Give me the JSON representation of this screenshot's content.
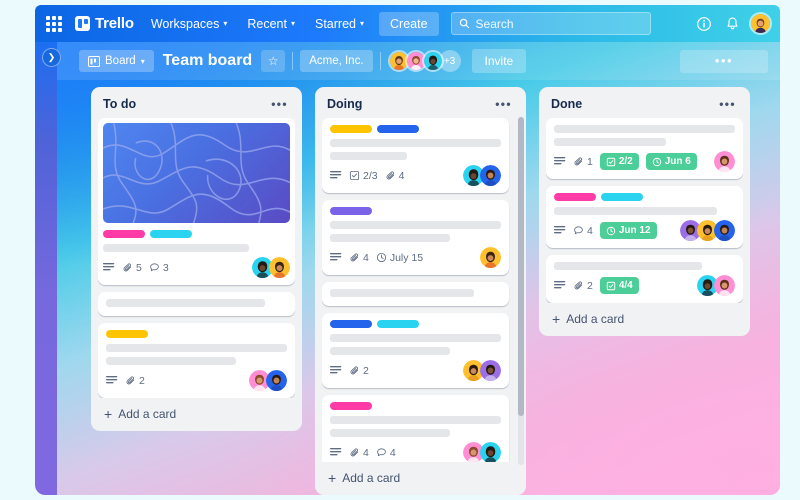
{
  "topnav": {
    "apps_icon": "grid-apps-icon",
    "brand": "Trello",
    "items": [
      {
        "label": "Workspaces",
        "caret": "▾"
      },
      {
        "label": "Recent",
        "caret": "▾"
      },
      {
        "label": "Starred",
        "caret": "▾"
      }
    ],
    "create_label": "Create",
    "search": {
      "placeholder": "Search",
      "value": "",
      "icon": "search-icon"
    },
    "info_icon": "info-icon",
    "bell_icon": "notification-bell-icon",
    "avatar": "user-avatar"
  },
  "board_header": {
    "sidebar_toggle_icon": "chevron-right-icon",
    "view_label": "Board",
    "view_caret": "▾",
    "view_icon": "board-view-icon",
    "title": "Team board",
    "star_icon": "☆",
    "workspace": "Acme, Inc.",
    "members": [
      {
        "name": "member-1",
        "face": "#ffc02e"
      },
      {
        "name": "member-2",
        "face": "#ff8ed4"
      },
      {
        "name": "member-3",
        "face": "#2ad4f0"
      }
    ],
    "overflow_count": "+3",
    "invite_label": "Invite",
    "menu_label": "•••"
  },
  "lists": [
    {
      "title": "To do",
      "menu": "•••",
      "add_card": "Add a card",
      "cards": [
        {
          "name": "card-cover-todo-1",
          "cover": true,
          "labels": [
            "#ff3ba8",
            "#2ad4f0"
          ],
          "skeletons": [
            100
          ],
          "meta": [
            {
              "icon": "description-icon",
              "text": ""
            },
            {
              "icon": "attachment-icon",
              "text": "5"
            },
            {
              "icon": "comment-icon",
              "text": "3"
            }
          ],
          "badges": [],
          "avatars": [
            "#2ad4f0",
            "#ffc02e"
          ]
        },
        {
          "name": "card-todo-2",
          "cover": false,
          "labels": [],
          "skeletons": [
            85
          ],
          "meta": [],
          "badges": [],
          "avatars": []
        },
        {
          "name": "card-todo-3",
          "cover": false,
          "labels": [
            "#ffc400"
          ],
          "skeletons": [
            100,
            76
          ],
          "meta": [
            {
              "icon": "description-icon",
              "text": ""
            },
            {
              "icon": "attachment-icon",
              "text": "2"
            }
          ],
          "badges": [],
          "avatars": [
            "#ff8ed4",
            "#2463eb"
          ]
        }
      ]
    },
    {
      "title": "Doing",
      "menu": "•••",
      "add_card": "Add a card",
      "scrollbar": true,
      "cards": [
        {
          "name": "card-doing-1",
          "cover": false,
          "labels": [
            "#ffc400",
            "#2463eb"
          ],
          "skeletons": [
            100,
            45
          ],
          "meta": [
            {
              "icon": "description-icon",
              "text": ""
            },
            {
              "icon": "checklist-icon",
              "text": "2/3"
            },
            {
              "icon": "attachment-icon",
              "text": "4"
            }
          ],
          "badges": [],
          "avatars": [
            "#2ad4f0",
            "#2463eb"
          ]
        },
        {
          "name": "card-doing-2",
          "cover": false,
          "labels": [
            "#7a63e8"
          ],
          "skeletons": [
            100,
            70
          ],
          "meta": [
            {
              "icon": "description-icon",
              "text": ""
            },
            {
              "icon": "attachment-icon",
              "text": "4"
            },
            {
              "icon": "clock-icon",
              "text": "July 15"
            }
          ],
          "badges": [],
          "avatars": [
            "#ffc02e"
          ]
        },
        {
          "name": "card-doing-3",
          "cover": false,
          "labels": [],
          "skeletons": [
            82
          ],
          "meta": [],
          "badges": [],
          "avatars": []
        },
        {
          "name": "card-doing-4",
          "cover": false,
          "labels": [
            "#2463eb",
            "#2ad4f0"
          ],
          "skeletons": [
            100,
            70
          ],
          "meta": [
            {
              "icon": "description-icon",
              "text": ""
            },
            {
              "icon": "attachment-icon",
              "text": "2"
            }
          ],
          "badges": [],
          "avatars": [
            "#ffc02e",
            "#9b6ee8"
          ]
        },
        {
          "name": "card-doing-5",
          "cover": false,
          "labels": [
            "#ff3ba8"
          ],
          "skeletons": [
            100,
            70
          ],
          "meta": [
            {
              "icon": "description-icon",
              "text": ""
            },
            {
              "icon": "attachment-icon",
              "text": "4"
            },
            {
              "icon": "comment-icon",
              "text": "4"
            }
          ],
          "badges": [],
          "avatars": [
            "#ff8ed4",
            "#2ad4f0"
          ]
        }
      ]
    },
    {
      "title": "Done",
      "menu": "•••",
      "add_card": "Add a card",
      "cards": [
        {
          "name": "card-done-1",
          "cover": false,
          "labels": [],
          "skeletons": [
            100,
            62
          ],
          "meta": [
            {
              "icon": "description-icon",
              "text": ""
            },
            {
              "icon": "attachment-icon",
              "text": "1"
            }
          ],
          "badges": [
            {
              "icon": "checklist-icon",
              "text": "2/2",
              "color": "#4bce97"
            },
            {
              "icon": "clock-icon",
              "text": "Jun 6",
              "color": "#4bce97"
            }
          ],
          "avatars": [
            "#ff8ed4"
          ]
        },
        {
          "name": "card-done-2",
          "cover": false,
          "labels": [
            "#ff3ba8",
            "#2ad4f0"
          ],
          "skeletons": [
            90
          ],
          "meta": [
            {
              "icon": "description-icon",
              "text": ""
            },
            {
              "icon": "comment-icon",
              "text": "4"
            }
          ],
          "badges": [
            {
              "icon": "clock-icon",
              "text": "Jun 12",
              "color": "#4bce97"
            }
          ],
          "avatars": [
            "#9b6ee8",
            "#ffc02e",
            "#2463eb"
          ]
        },
        {
          "name": "card-done-3",
          "cover": false,
          "labels": [],
          "skeletons": [
            82
          ],
          "meta": [
            {
              "icon": "description-icon",
              "text": ""
            },
            {
              "icon": "attachment-icon",
              "text": "2"
            }
          ],
          "badges": [
            {
              "icon": "checklist-icon",
              "text": "4/4",
              "color": "#4bce97"
            }
          ],
          "avatars": [
            "#2ad4f0",
            "#ff8ed4"
          ]
        }
      ]
    }
  ],
  "colors": {
    "brand_blue": "#1d7afc",
    "accent_cyan": "#3fd1e8",
    "accent_pink": "#fbb6e2",
    "green_badge": "#4bce97",
    "list_bg": "#f1f2f4",
    "page_bg": "#eafafd"
  }
}
